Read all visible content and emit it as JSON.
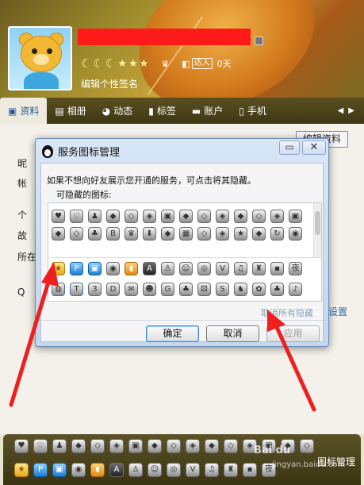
{
  "profile": {
    "signature": "编辑个性签名",
    "talent_label": "达人",
    "talent_days": "0天"
  },
  "tabs": [
    {
      "label": "资料",
      "icon": "id-card-icon",
      "active": true
    },
    {
      "label": "相册",
      "icon": "photo-icon"
    },
    {
      "label": "动态",
      "icon": "activity-icon"
    },
    {
      "label": "标签",
      "icon": "bookmark-icon"
    },
    {
      "label": "账户",
      "icon": "wallet-icon"
    },
    {
      "label": "手机",
      "icon": "phone-icon"
    }
  ],
  "edit_profile_button": "编辑资料",
  "side_labels": [
    "昵",
    "帐",
    "个",
    "故",
    "所在",
    "Q"
  ],
  "set_link": "设置",
  "dialog": {
    "title": "服务图标管理",
    "hint": "如果不想向好友展示您开通的服务，可点击将其隐藏。",
    "sub": "可隐藏的图标:",
    "cancel_all": "取消所有隐藏",
    "ok": "确定",
    "cancel": "取消",
    "apply": "应用",
    "minimize_glyph": "▭",
    "close_glyph": "✕"
  },
  "manage_link": "图标管理",
  "watermark": {
    "brand": "Bai du",
    "sub": "jingyan.baidu.com"
  },
  "colors": {
    "redaction": "#ff1a1a",
    "arrow": "#ee1f1f",
    "link": "#2a6bb5"
  }
}
